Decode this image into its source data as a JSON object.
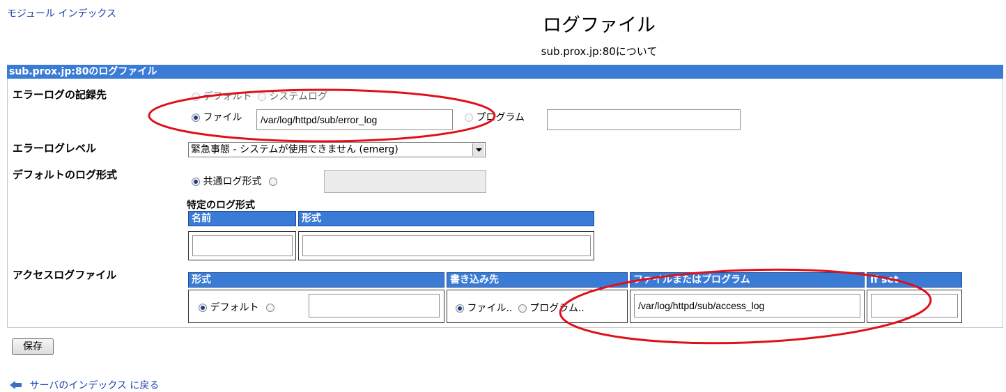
{
  "header": {
    "module_index_link": "モジュール インデックス",
    "title": "ログファイル",
    "subtitle": "sub.prox.jp:80について"
  },
  "section_bar": "sub.prox.jp:80のログファイル",
  "error_log_dest": {
    "label": "エラーログの記録先",
    "opt_default": "デフォルト",
    "opt_syslog": "システムログ",
    "opt_file": "ファイル",
    "file_value": "/var/log/httpd/sub/error_log",
    "opt_program": "プログラム",
    "program_value": ""
  },
  "error_log_level": {
    "label": "エラーログレベル",
    "selected": "緊急事態 - システムが使用できません (emerg)"
  },
  "default_log_format": {
    "label": "デフォルトのログ形式",
    "opt_common": "共通ログ形式",
    "custom_value": "",
    "specific_title": "特定のログ形式",
    "col_name": "名前",
    "col_format": "形式",
    "name_value": "",
    "format_value": ""
  },
  "access_log": {
    "label": "アクセスログファイル",
    "col_format": "形式",
    "col_dest": "書き込み先",
    "col_file_or_program": "ファイルまたはプログラム",
    "col_if_set": "If set",
    "opt_default": "デフォルト",
    "format_value": "",
    "opt_file": "ファイル..",
    "opt_program": "プログラム..",
    "path_value": "/var/log/httpd/sub/access_log",
    "if_set_value": ""
  },
  "save_button": "保存",
  "footer": {
    "back_link": "サーバのインデックス に戻る"
  },
  "colors": {
    "header_bar": "#3a7bd5",
    "annotation": "#e0101a",
    "link": "#1a3fb0"
  }
}
